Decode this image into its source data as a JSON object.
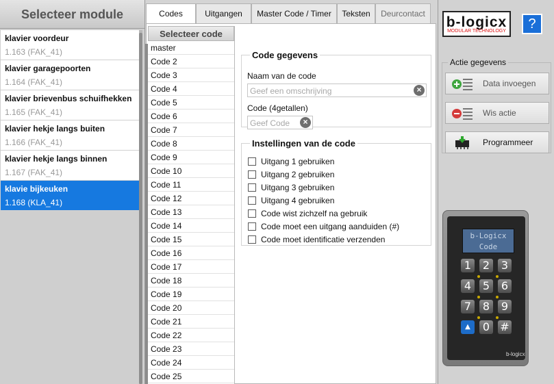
{
  "modules": {
    "title": "Selecteer module",
    "items": [
      {
        "name": "klavier voordeur",
        "sub": "1.163 (FAK_41)"
      },
      {
        "name": "klavier garagepoorten",
        "sub": "1.164 (FAK_41)"
      },
      {
        "name": "klavier brievenbus schuifhekken",
        "sub": "1.165 (FAK_41)"
      },
      {
        "name": "klavier hekje langs buiten",
        "sub": "1.166 (FAK_41)"
      },
      {
        "name": "klavier hekje langs binnen",
        "sub": "1.167 (FAK_41)"
      },
      {
        "name": "klavie bijkeuken",
        "sub": "1.168 (KLA_41)"
      }
    ],
    "selected_index": 5
  },
  "tabs": [
    "Codes",
    "Uitgangen",
    "Master Code / Timer",
    "Teksten",
    "Deurcontact"
  ],
  "active_tab": "Codes",
  "code_list": {
    "title": "Selecteer code",
    "items": [
      "master",
      "Code 2",
      "Code 3",
      "Code 4",
      "Code 5",
      "Code 6",
      "Code 7",
      "Code 8",
      "Code 9",
      "Code 10",
      "Code 11",
      "Code 12",
      "Code 13",
      "Code 14",
      "Code 15",
      "Code 16",
      "Code 17",
      "Code 18",
      "Code 19",
      "Code 20",
      "Code 21",
      "Code 22",
      "Code 23",
      "Code 24",
      "Code 25"
    ]
  },
  "code_gegevens": {
    "title": "Code gegevens",
    "name_label": "Naam van de code",
    "name_placeholder": "Geef een omschrijving",
    "code_label": "Code (4getallen)",
    "code_placeholder": "Geef Code"
  },
  "instellingen": {
    "title": "Instellingen van de code",
    "options": [
      {
        "label": "Uitgang 1 gebruiken",
        "checked": false
      },
      {
        "label": "Uitgang 2 gebruiken",
        "checked": false
      },
      {
        "label": "Uitgang 3 gebruiken",
        "checked": false
      },
      {
        "label": "Uitgang 4 gebruiken",
        "checked": false
      },
      {
        "label": "Code wist zichzelf na gebruik",
        "checked": false
      },
      {
        "label": "Code moet een uitgang aanduiden (#)",
        "checked": false
      },
      {
        "label": "Code moet identificatie verzenden",
        "checked": false
      }
    ]
  },
  "logo": {
    "text": "b-logicx",
    "tagline": "MODULAR TECHNOLOGY"
  },
  "help_label": "?",
  "actie": {
    "title": "Actie gegevens",
    "buttons": [
      {
        "label": "Data invoegen",
        "icon": "add-list-icon"
      },
      {
        "label": "Wis actie",
        "icon": "remove-list-icon"
      },
      {
        "label": "Programmeer",
        "icon": "chip-program-icon"
      }
    ]
  },
  "keypad": {
    "display_line1": "b-Logicx",
    "display_line2": "Code",
    "keys": [
      "1",
      "2",
      "3",
      "4",
      "5",
      "6",
      "7",
      "8",
      "9",
      "",
      "0",
      "#"
    ],
    "brand": "b-logicx"
  }
}
